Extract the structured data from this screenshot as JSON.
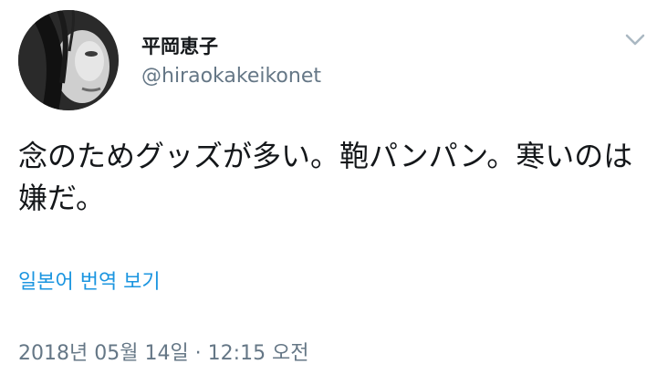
{
  "author": {
    "display_name": "平岡恵子",
    "handle": "@hiraokakeikonet"
  },
  "icons": {
    "avatar": "profile-photo",
    "more": "chevron-down-icon"
  },
  "tweet": {
    "text": "念のためグッズが多い。鞄パンパン。寒いのは嫌だ。",
    "translate_label": "일본어 번역 보기",
    "timestamp": "2018년 05월 14일 · 12:15 오전"
  },
  "colors": {
    "link": "#1b95e0",
    "secondary_text": "#657786",
    "primary_text": "#14171a"
  }
}
